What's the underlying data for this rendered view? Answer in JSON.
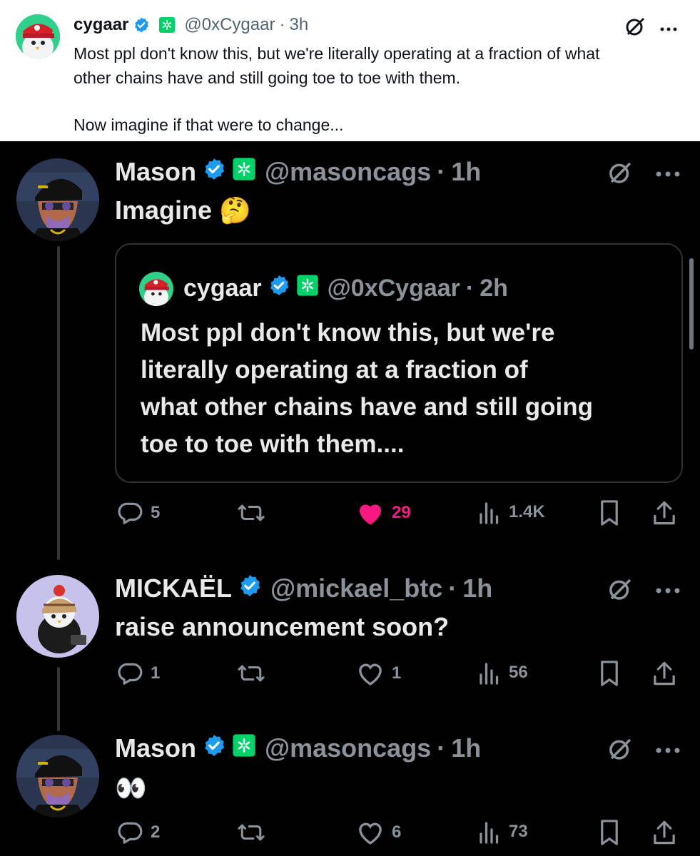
{
  "top_tweet": {
    "name": "cygaar",
    "handle": "@0xCygaar",
    "time": "3h",
    "separator": "·",
    "text_line1": "Most ppl don't know this, but we're literally operating at a fraction of what",
    "text_line2": "other chains have and still going toe to toe with them.",
    "text_line3": "Now imagine if that were to change..."
  },
  "tweets": [
    {
      "name": "Mason",
      "handle": "@masoncags",
      "time": "1h",
      "separator": "·",
      "text": "Imagine 🤔",
      "quote": {
        "name": "cygaar",
        "handle": "@0xCygaar",
        "time": "2h",
        "separator": "·",
        "lines": [
          "Most ppl don't know this, but we're",
          "literally operating at a fraction of",
          "what other chains have and still going",
          "toe to toe with them...."
        ]
      },
      "actions": {
        "replies": "5",
        "reposts": "",
        "likes": "29",
        "views": "1.4K"
      },
      "liked": true
    },
    {
      "name": "MICKAËL",
      "handle": "@mickael_btc",
      "time": "1h",
      "separator": "·",
      "text": "raise announcement soon?",
      "actions": {
        "replies": "1",
        "reposts": "",
        "likes": "1",
        "views": "56"
      },
      "liked": false
    },
    {
      "name": "Mason",
      "handle": "@masoncags",
      "time": "1h",
      "separator": "·",
      "text": "👀",
      "actions": {
        "replies": "2",
        "reposts": "",
        "likes": "6",
        "views": "73"
      },
      "liked": false
    }
  ],
  "colors": {
    "verified": "#1d9bf0",
    "affiliate": "#00d26a",
    "like_active": "#f91880",
    "action_gray": "#8b9299"
  },
  "icons": [
    "verified-badge-icon",
    "affiliate-badge-icon",
    "grok-icon",
    "more-icon",
    "reply-icon",
    "repost-icon",
    "heart-icon",
    "views-icon",
    "bookmark-icon",
    "share-icon"
  ]
}
